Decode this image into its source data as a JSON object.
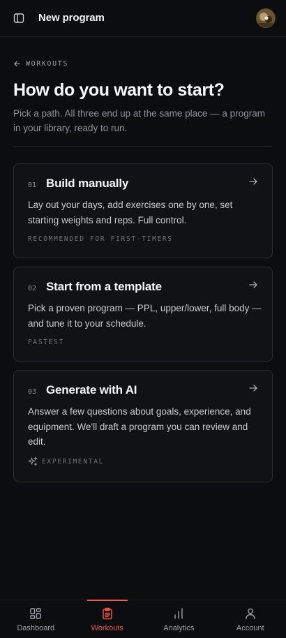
{
  "header": {
    "title": "New program",
    "sidebar_icon": "sidebar-toggle-icon",
    "avatar_icon": "avatar"
  },
  "back": {
    "label": "WORKOUTS",
    "icon": "arrow-left-icon"
  },
  "page": {
    "title": "How do you want to start?",
    "subtitle": "Pick a path. All three end up at the same place — a program in your library, ready to run."
  },
  "options": [
    {
      "number": "01",
      "title": "Build manually",
      "description": "Lay out your days, add exercises one by one, set starting weights and reps. Full control.",
      "tag": "RECOMMENDED FOR FIRST-TIMERS"
    },
    {
      "number": "02",
      "title": "Start from a template",
      "description": "Pick a proven program — PPL, upper/lower, full body — and tune it to your schedule.",
      "tag": "FASTEST"
    },
    {
      "number": "03",
      "title": "Generate with AI",
      "description": "Answer a few questions about goals, experience, and equipment. We'll draft a program you can review and edit.",
      "tag": "EXPERIMENTAL",
      "tag_icon": "sparkles-icon"
    }
  ],
  "nav": {
    "items": [
      {
        "label": "Dashboard",
        "icon": "dashboard-icon"
      },
      {
        "label": "Workouts",
        "icon": "clipboard-icon",
        "active": true
      },
      {
        "label": "Analytics",
        "icon": "bar-chart-icon"
      },
      {
        "label": "Account",
        "icon": "user-icon"
      }
    ]
  },
  "colors": {
    "accent": "#f0584f",
    "background": "#0c0d0f",
    "card": "#111215"
  }
}
